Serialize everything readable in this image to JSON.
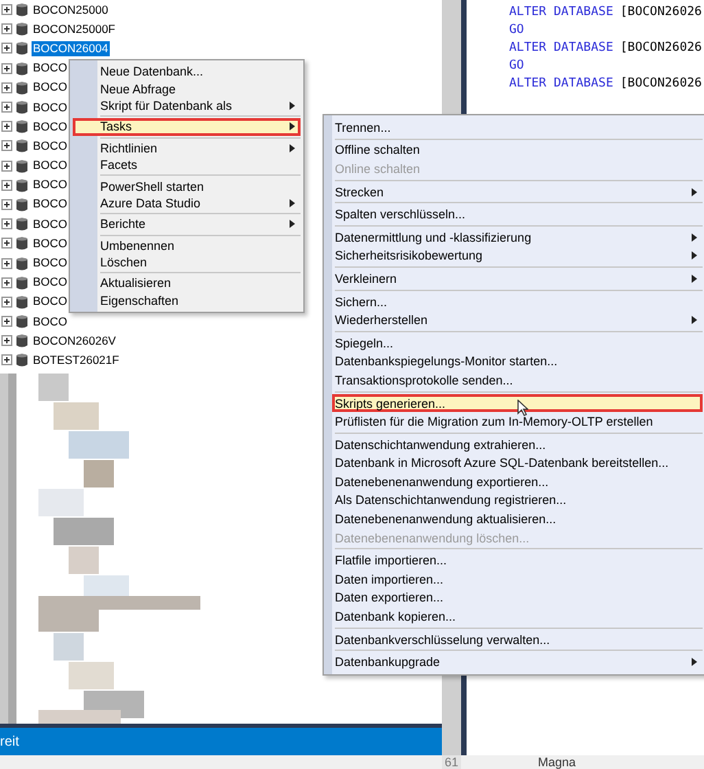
{
  "tree": {
    "items": [
      {
        "label": "BOCON25000",
        "selected": false
      },
      {
        "label": "BOCON25000F",
        "selected": false
      },
      {
        "label": "BOCON26004",
        "selected": true
      },
      {
        "label": "BOCO",
        "selected": false
      },
      {
        "label": "BOCO",
        "selected": false
      },
      {
        "label": "BOCO",
        "selected": false
      },
      {
        "label": "BOCO",
        "selected": false
      },
      {
        "label": "BOCO",
        "selected": false
      },
      {
        "label": "BOCO",
        "selected": false
      },
      {
        "label": "BOCO",
        "selected": false
      },
      {
        "label": "BOCO",
        "selected": false
      },
      {
        "label": "BOCO",
        "selected": false
      },
      {
        "label": "BOCO",
        "selected": false
      },
      {
        "label": "BOCO",
        "selected": false
      },
      {
        "label": "BOCO",
        "selected": false
      },
      {
        "label": "BOCO",
        "selected": false
      },
      {
        "label": "BOCO",
        "selected": false
      },
      {
        "label": "BOCON26026V",
        "selected": false
      },
      {
        "label": "BOTEST26021F",
        "selected": false
      }
    ]
  },
  "editor": {
    "lines": [
      {
        "keyword": "ALTER DATABASE",
        "text": "[BOCON26026"
      },
      {
        "keyword": "GO"
      },
      {
        "keyword": "ALTER DATABASE",
        "text": "[BOCON26026"
      },
      {
        "keyword": "GO"
      },
      {
        "keyword": "ALTER DATABASE",
        "text": "[BOCON26026"
      }
    ]
  },
  "status_bar": {
    "text": "reit"
  },
  "results_row": {
    "line_number": "61",
    "text": "Magna"
  },
  "context_menu": {
    "groups": [
      [
        {
          "label": "Neue Datenbank...",
          "submenu": false,
          "selected": false,
          "annotated": false
        },
        {
          "label": "Neue Abfrage",
          "submenu": false,
          "selected": false,
          "annotated": false
        },
        {
          "label": "Skript für Datenbank als",
          "submenu": true,
          "selected": false,
          "annotated": false
        }
      ],
      [
        {
          "label": "Tasks",
          "submenu": true,
          "selected": true,
          "annotated": true
        }
      ],
      [
        {
          "label": "Richtlinien",
          "submenu": true,
          "selected": false,
          "annotated": false
        },
        {
          "label": "Facets",
          "submenu": false,
          "selected": false,
          "annotated": false
        }
      ],
      [
        {
          "label": "PowerShell starten",
          "submenu": false,
          "selected": false,
          "annotated": false
        },
        {
          "label": "Azure Data Studio",
          "submenu": true,
          "selected": false,
          "annotated": false
        }
      ],
      [
        {
          "label": "Berichte",
          "submenu": true,
          "selected": false,
          "annotated": false
        }
      ],
      [
        {
          "label": "Umbenennen",
          "submenu": false,
          "selected": false,
          "annotated": false
        },
        {
          "label": "Löschen",
          "submenu": false,
          "selected": false,
          "annotated": false
        }
      ],
      [
        {
          "label": "Aktualisieren",
          "submenu": false,
          "selected": false,
          "annotated": false
        },
        {
          "label": "Eigenschaften",
          "submenu": false,
          "selected": false,
          "annotated": false
        }
      ]
    ]
  },
  "tasks_submenu": {
    "groups": [
      [
        {
          "label": "Trennen...",
          "submenu": false,
          "selected": false,
          "disabled": false,
          "annotated": false
        }
      ],
      [
        {
          "label": "Offline schalten",
          "submenu": false,
          "selected": false,
          "disabled": false,
          "annotated": false
        },
        {
          "label": "Online schalten",
          "submenu": false,
          "selected": false,
          "disabled": true,
          "annotated": false
        }
      ],
      [
        {
          "label": "Strecken",
          "submenu": true,
          "selected": false,
          "disabled": false,
          "annotated": false
        }
      ],
      [
        {
          "label": "Spalten verschlüsseln...",
          "submenu": false,
          "selected": false,
          "disabled": false,
          "annotated": false
        }
      ],
      [
        {
          "label": "Datenermittlung und -klassifizierung",
          "submenu": true,
          "selected": false,
          "disabled": false,
          "annotated": false
        },
        {
          "label": "Sicherheitsrisikobewertung",
          "submenu": true,
          "selected": false,
          "disabled": false,
          "annotated": false
        }
      ],
      [
        {
          "label": "Verkleinern",
          "submenu": true,
          "selected": false,
          "disabled": false,
          "annotated": false
        }
      ],
      [
        {
          "label": "Sichern...",
          "submenu": false,
          "selected": false,
          "disabled": false,
          "annotated": false
        },
        {
          "label": "Wiederherstellen",
          "submenu": true,
          "selected": false,
          "disabled": false,
          "annotated": false
        }
      ],
      [
        {
          "label": "Spiegeln...",
          "submenu": false,
          "selected": false,
          "disabled": false,
          "annotated": false
        },
        {
          "label": "Datenbankspiegelungs-Monitor starten...",
          "submenu": false,
          "selected": false,
          "disabled": false,
          "annotated": false
        },
        {
          "label": "Transaktionsprotokolle senden...",
          "submenu": false,
          "selected": false,
          "disabled": false,
          "annotated": false
        }
      ],
      [
        {
          "label": "Skripts generieren...",
          "submenu": false,
          "selected": true,
          "disabled": false,
          "annotated": true
        },
        {
          "label": "Prüflisten für die Migration zum In-Memory-OLTP erstellen",
          "submenu": false,
          "selected": false,
          "disabled": false,
          "annotated": false
        }
      ],
      [
        {
          "label": "Datenschichtanwendung extrahieren...",
          "submenu": false,
          "selected": false,
          "disabled": false,
          "annotated": false
        },
        {
          "label": "Datenbank in Microsoft Azure SQL-Datenbank bereitstellen...",
          "submenu": false,
          "selected": false,
          "disabled": false,
          "annotated": false
        },
        {
          "label": "Datenebenenanwendung exportieren...",
          "submenu": false,
          "selected": false,
          "disabled": false,
          "annotated": false
        },
        {
          "label": "Als Datenschichtanwendung registrieren...",
          "submenu": false,
          "selected": false,
          "disabled": false,
          "annotated": false
        },
        {
          "label": "Datenebenenanwendung aktualisieren...",
          "submenu": false,
          "selected": false,
          "disabled": false,
          "annotated": false
        },
        {
          "label": "Datenebenenanwendung löschen...",
          "submenu": false,
          "selected": false,
          "disabled": true,
          "annotated": false
        }
      ],
      [
        {
          "label": "Flatfile importieren...",
          "submenu": false,
          "selected": false,
          "disabled": false,
          "annotated": false
        },
        {
          "label": "Daten importieren...",
          "submenu": false,
          "selected": false,
          "disabled": false,
          "annotated": false
        },
        {
          "label": "Daten exportieren...",
          "submenu": false,
          "selected": false,
          "disabled": false,
          "annotated": false
        },
        {
          "label": "Datenbank kopieren...",
          "submenu": false,
          "selected": false,
          "disabled": false,
          "annotated": false
        }
      ],
      [
        {
          "label": "Datenbankverschlüsselung verwalten...",
          "submenu": false,
          "selected": false,
          "disabled": false,
          "annotated": false
        }
      ],
      [
        {
          "label": "Datenbankupgrade",
          "submenu": true,
          "selected": false,
          "disabled": false,
          "annotated": false
        }
      ]
    ]
  }
}
